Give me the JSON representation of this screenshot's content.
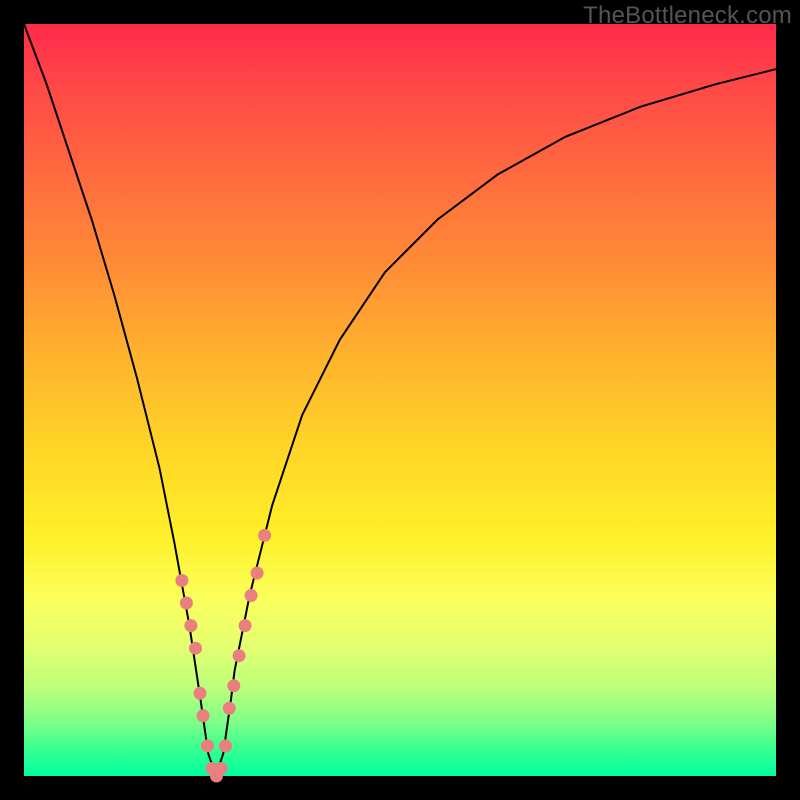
{
  "watermark": "TheBottleneck.com",
  "colors": {
    "frame": "#000000",
    "curve": "#000000",
    "marker": "#e97f7f",
    "gradient_top": "#ff2a4a",
    "gradient_bottom": "#00ffa0"
  },
  "chart_data": {
    "type": "line",
    "title": "",
    "xlabel": "",
    "ylabel": "",
    "xlim": [
      0,
      100
    ],
    "ylim": [
      0,
      100
    ],
    "annotations": [
      "TheBottleneck.com"
    ],
    "legend": false,
    "grid": false,
    "series": [
      {
        "name": "bottleneck-curve",
        "x": [
          0,
          3,
          6,
          9,
          12,
          15,
          18,
          20,
          22,
          23.5,
          24.5,
          25.5,
          26.5,
          27.5,
          28,
          30,
          33,
          37,
          42,
          48,
          55,
          63,
          72,
          82,
          92,
          100
        ],
        "y": [
          100,
          92,
          83,
          74,
          64,
          53,
          41,
          31,
          20,
          10,
          3,
          0,
          3,
          10,
          14,
          24,
          36,
          48,
          58,
          67,
          74,
          80,
          85,
          89,
          92,
          94
        ]
      }
    ],
    "markers": [
      {
        "name": "left-arm-cluster",
        "x": [
          21.0,
          21.6,
          22.2,
          22.8,
          23.4,
          23.8
        ],
        "y": [
          26,
          23,
          20,
          17,
          11,
          8
        ]
      },
      {
        "name": "right-arm-cluster",
        "x": [
          27.3,
          27.9,
          28.6,
          29.4,
          30.2,
          31.0,
          32.0
        ],
        "y": [
          9,
          12,
          16,
          20,
          24,
          27,
          32
        ]
      },
      {
        "name": "valley-bottom",
        "x": [
          24.4,
          25.0,
          25.6,
          26.2,
          26.8
        ],
        "y": [
          4,
          1,
          0,
          1,
          4
        ]
      }
    ]
  }
}
